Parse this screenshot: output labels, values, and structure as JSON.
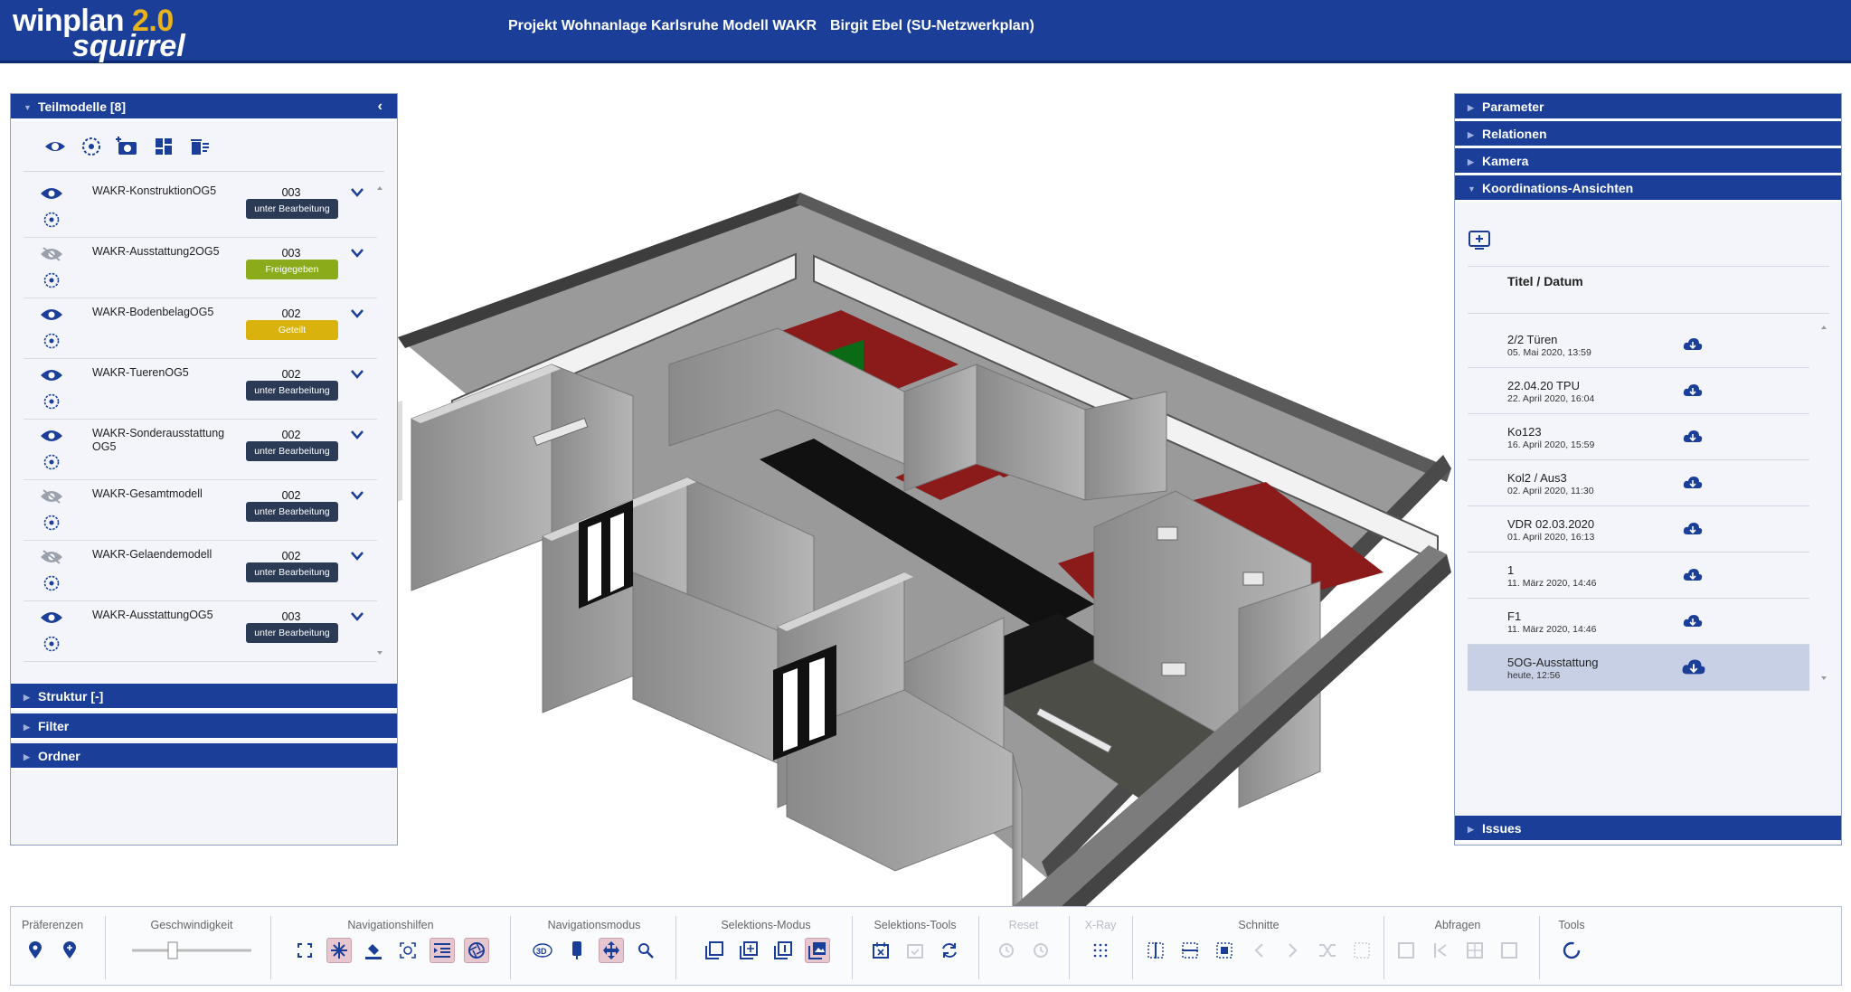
{
  "header": {
    "logo_main": "winplan",
    "logo_version": "2.0",
    "logo_sub": "squirrel",
    "project": "Projekt Wohnanlage Karlsruhe Modell WAKR",
    "user": "Birgit Ebel (SU-Netzwerkplan)"
  },
  "left": {
    "teilmodelle_title": "Teilmodelle [8]",
    "items": [
      {
        "name": "WAKR-KonstruktionOG5",
        "version": "003",
        "status": "unter Bearbeitung",
        "status_color": "#2b3a55",
        "visible": true
      },
      {
        "name": "WAKR-Ausstattung2OG5",
        "version": "003",
        "status": "Freigegeben",
        "status_color": "#8aac1a",
        "visible": false
      },
      {
        "name": "WAKR-BodenbelagOG5",
        "version": "002",
        "status": "Geteilt",
        "status_color": "#d9b20d",
        "visible": true
      },
      {
        "name": "WAKR-TuerenOG5",
        "version": "002",
        "status": "unter Bearbeitung",
        "status_color": "#2b3a55",
        "visible": true
      },
      {
        "name": "WAKR-SonderausstattungOG5",
        "version": "002",
        "status": "unter Bearbeitung",
        "status_color": "#2b3a55",
        "visible": true
      },
      {
        "name": "WAKR-Gesamtmodell",
        "version": "002",
        "status": "unter Bearbeitung",
        "status_color": "#2b3a55",
        "visible": false
      },
      {
        "name": "WAKR-Gelaendemodell",
        "version": "002",
        "status": "unter Bearbeitung",
        "status_color": "#2b3a55",
        "visible": false
      },
      {
        "name": "WAKR-AusstattungOG5",
        "version": "003",
        "status": "unter Bearbeitung",
        "status_color": "#2b3a55",
        "visible": true
      }
    ],
    "struktur": "Struktur [-]",
    "filter": "Filter",
    "ordner": "Ordner"
  },
  "right": {
    "parameter": "Parameter",
    "relationen": "Relationen",
    "kamera": "Kamera",
    "koordinations": "Koordinations-Ansichten",
    "col_header": "Titel / Datum",
    "views": [
      {
        "title": "2/2 Türen",
        "date": "05. Mai 2020, 13:59"
      },
      {
        "title": "22.04.20 TPU",
        "date": "22. April 2020, 16:04"
      },
      {
        "title": "Ko123",
        "date": "16. April 2020, 15:59"
      },
      {
        "title": "Kol2 / Aus3",
        "date": "02. April 2020, 11:30"
      },
      {
        "title": "VDR 02.03.2020",
        "date": "01. April 2020, 16:13"
      },
      {
        "title": "1",
        "date": "11. März 2020, 14:46"
      },
      {
        "title": "F1",
        "date": "11. März 2020, 14:46"
      },
      {
        "title": "5OG-Ausstattung",
        "date": "heute, 12:56"
      }
    ],
    "issues": "Issues"
  },
  "toolbar": {
    "praeferenzen": "Präferenzen",
    "geschwindigkeit": "Geschwindigkeit",
    "navigationshilfen": "Navigationshilfen",
    "navigationsmodus": "Navigationsmodus",
    "selektionsmodus": "Selektions-Modus",
    "selektionstools": "Selektions-Tools",
    "reset": "Reset",
    "xray": "X-Ray",
    "schnitte": "Schnitte",
    "abfragen": "Abfragen",
    "tools": "Tools"
  },
  "colors": {
    "brand": "#1b3e99",
    "accent": "#e8b41d"
  }
}
